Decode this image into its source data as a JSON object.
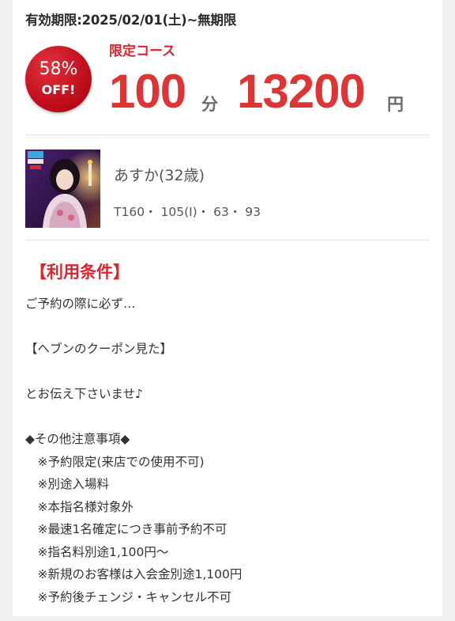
{
  "validity": "有効期限:2025/02/01(土)~無期限",
  "badge": {
    "percent": "58%",
    "off": "OFF!"
  },
  "course": {
    "label": "限定コース",
    "minutes": "100",
    "minutes_unit": "分",
    "price": "13200",
    "price_unit": "円"
  },
  "profile": {
    "name": "あすか(32歳)",
    "specs": "T160・ 105(I)・ 63・ 93",
    "photo_icon": "person-photo-icon"
  },
  "conditions": {
    "title": "【利用条件】",
    "lines": [
      "ご予約の際に必ず…",
      "",
      "【ヘブンのクーポン見た】",
      "",
      "とお伝え下さいませ♪",
      "",
      "◆その他注意事項◆",
      "　※予約限定(来店での使用不可)",
      "　※別途入場料",
      "　※本指名様対象外",
      "　※最速1名確定につき事前予約不可",
      "　※指名料別途1,100円〜",
      "　※新規のお客様は入会金別途1,100円",
      "　※予約後チェンジ・キャンセル不可"
    ]
  },
  "colors": {
    "accent": "#d9262f",
    "price": "#df3434",
    "badge": "#c4101e",
    "unit": "#6b6b6b",
    "frame": "#f0f0f0"
  }
}
